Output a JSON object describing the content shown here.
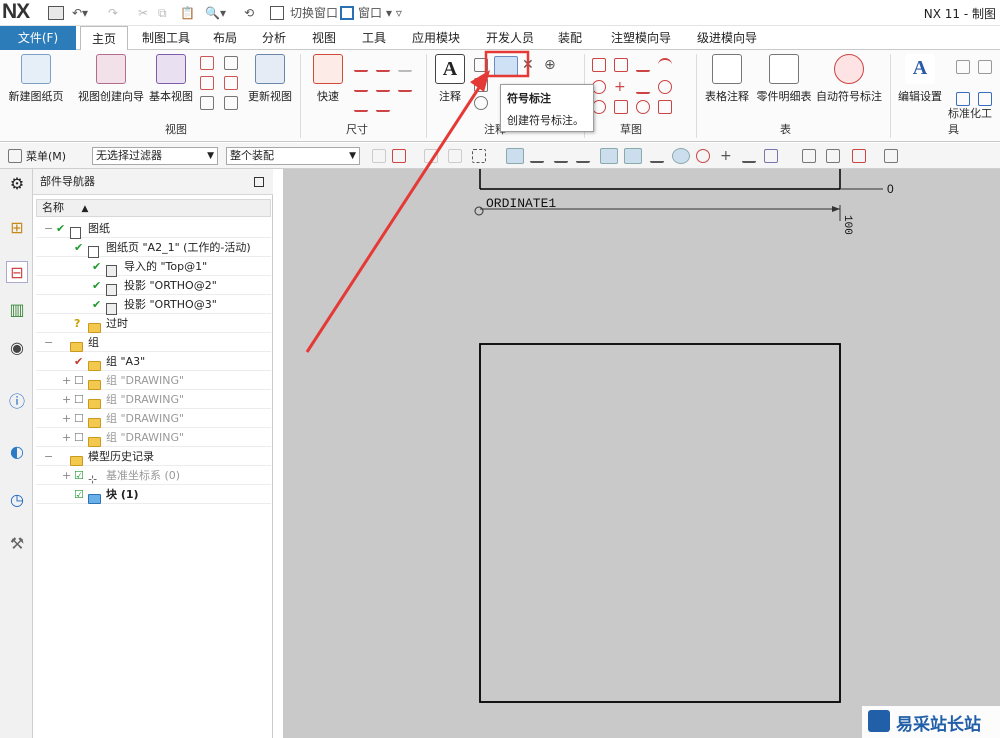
{
  "app": {
    "logo": "NX",
    "title": "NX 11 - 制图"
  },
  "quick_access": {
    "switch_window": "切换窗口",
    "window": "窗口"
  },
  "ribbon_tabs": [
    "文件(F)",
    "主页",
    "制图工具",
    "布局",
    "分析",
    "视图",
    "工具",
    "应用模块",
    "开发人员",
    "装配",
    "注塑模向导",
    "级进模向导"
  ],
  "ribbon": {
    "view_group": {
      "label": "视图",
      "new_sheet": "新建图纸页",
      "view_wizard": "视图创建向导",
      "base_view": "基本视图",
      "update_view": "更新视图"
    },
    "dimension_group": {
      "label": "尺寸",
      "quick": "快速"
    },
    "annotation_group": {
      "label": "注释",
      "note": "注释"
    },
    "sketch_group": {
      "label": "草图"
    },
    "table_group": {
      "label": "表",
      "table_note": "表格注释",
      "parts_list": "零件明细表",
      "auto_balloon": "自动符号标注"
    },
    "standard_group": {
      "label": "标准化工具",
      "edit_settings": "编辑设置"
    }
  },
  "tooltip": {
    "title": "符号标注",
    "body": "创建符号标注。"
  },
  "command_bar": {
    "menu": "菜单(M)",
    "filter": "无选择过滤器",
    "scope": "整个装配"
  },
  "navigator": {
    "title": "部件导航器",
    "column": "名称",
    "rows": [
      {
        "text": "图纸",
        "indent": 0,
        "icon": "sheet",
        "check": true
      },
      {
        "text": "图纸页 \"A2_1\" (工作的-活动)",
        "indent": 1,
        "icon": "sheet",
        "check": true
      },
      {
        "text": "导入的 \"Top@1\"",
        "indent": 2,
        "icon": "view",
        "check": true
      },
      {
        "text": "投影 \"ORTHO@2\"",
        "indent": 2,
        "icon": "view",
        "check": true
      },
      {
        "text": "投影 \"ORTHO@3\"",
        "indent": 2,
        "icon": "view",
        "check": true
      },
      {
        "text": "过时",
        "indent": 1,
        "icon": "folder",
        "check": false,
        "question": true
      },
      {
        "text": "组",
        "indent": 0,
        "icon": "folder",
        "check": false
      },
      {
        "text": "组 \"A3\"",
        "indent": 1,
        "icon": "folder",
        "check": true,
        "red": true
      },
      {
        "text": "组 \"DRAWING\"",
        "indent": 1,
        "icon": "folder",
        "dim": true
      },
      {
        "text": "组 \"DRAWING\"",
        "indent": 1,
        "icon": "folder",
        "dim": true
      },
      {
        "text": "组 \"DRAWING\"",
        "indent": 1,
        "icon": "folder",
        "dim": true
      },
      {
        "text": "组 \"DRAWING\"",
        "indent": 1,
        "icon": "folder",
        "dim": true
      },
      {
        "text": "模型历史记录",
        "indent": 0,
        "icon": "folder",
        "check": false
      },
      {
        "text": "基准坐标系 (0)",
        "indent": 1,
        "icon": "datum",
        "box": true,
        "dim": true
      },
      {
        "text": "块 (1)",
        "indent": 1,
        "icon": "block",
        "box": true,
        "bold": true
      }
    ]
  },
  "canvas": {
    "dim_label": "ORDINATE1",
    "zero": "0",
    "vert_dim": "100"
  },
  "watermark": "易采站长站"
}
